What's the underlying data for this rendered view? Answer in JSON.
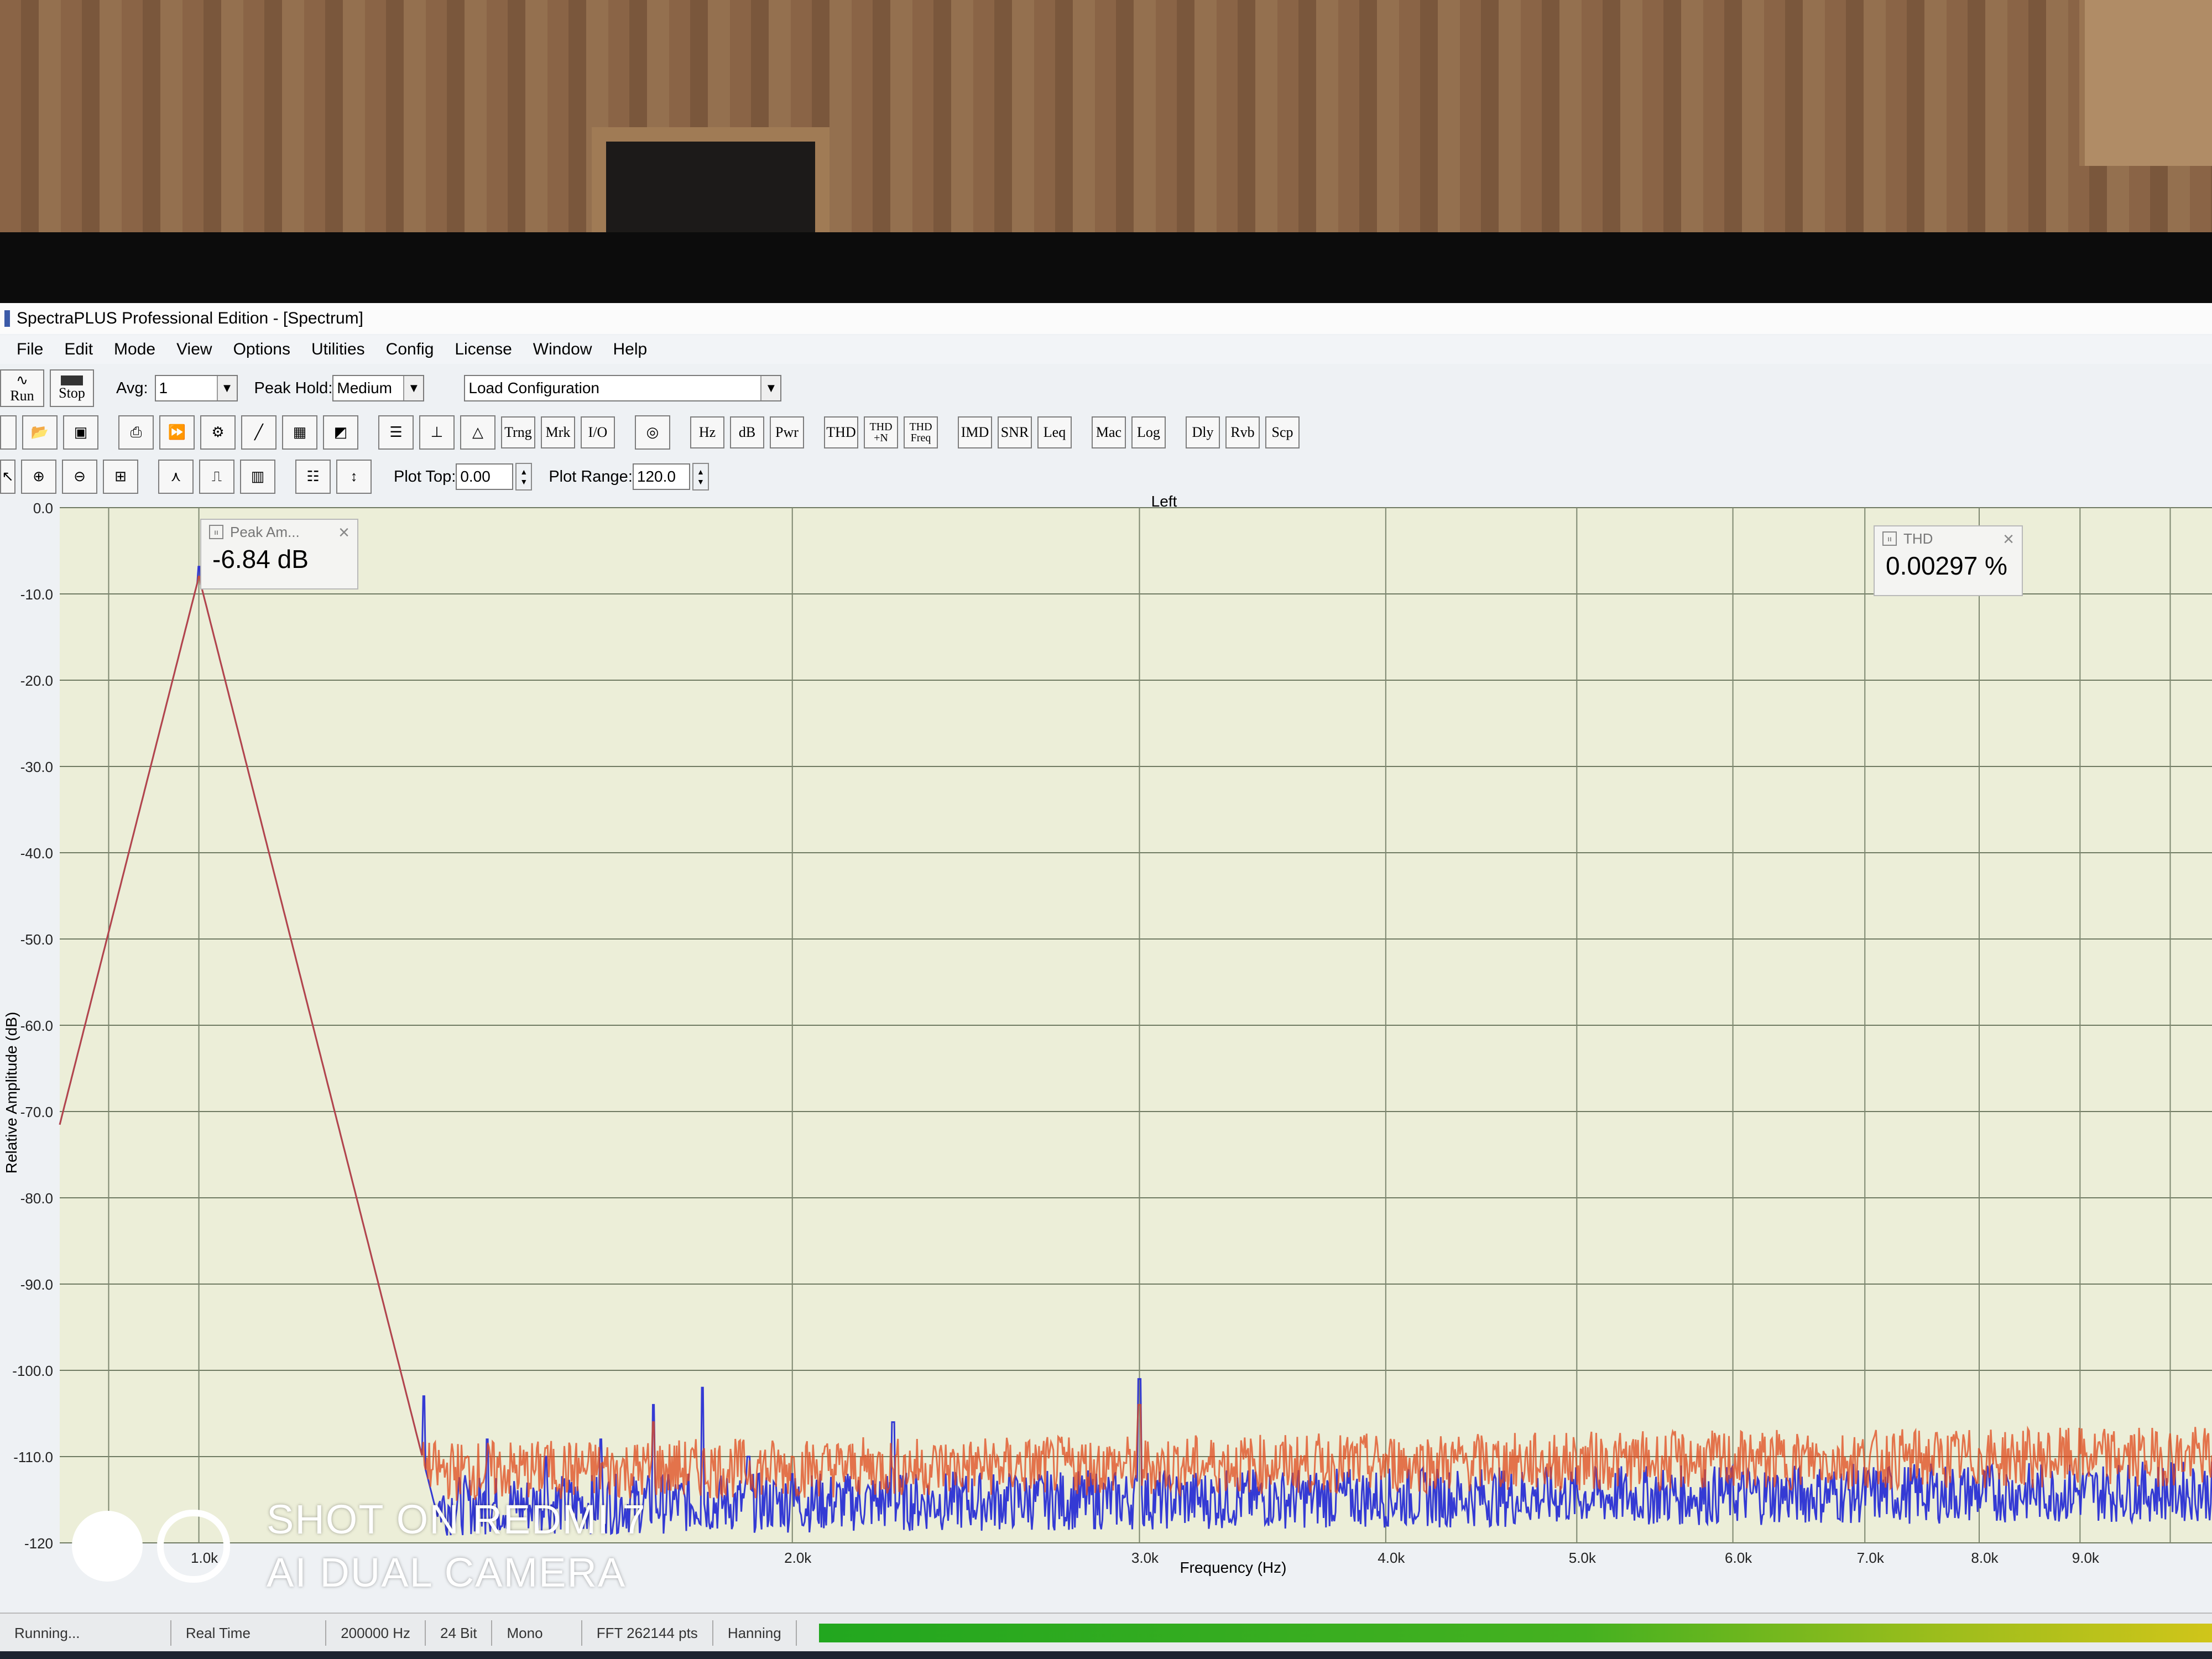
{
  "window": {
    "title": "SpectraPLUS Professional Edition - [Spectrum]"
  },
  "menu": [
    "File",
    "Edit",
    "Mode",
    "View",
    "Options",
    "Utilities",
    "Config",
    "License",
    "Window",
    "Help"
  ],
  "toolbar1": {
    "run_label": "Run",
    "stop_label": "Stop",
    "avg_label": "Avg:",
    "avg_value": "1",
    "peak_hold_label": "Peak Hold:",
    "peak_hold_value": "Medium",
    "config_value": "Load Configuration"
  },
  "toolbar2": {
    "text_buttons": [
      "Hz",
      "dB",
      "Pwr",
      "THD",
      "THD +N",
      "THD Freq",
      "IMD",
      "SNR",
      "Leq",
      "Mac",
      "Log",
      "Dly",
      "Rvb",
      "Scp"
    ]
  },
  "toolbar3": {
    "plot_top_label": "Plot Top:",
    "plot_top_value": "0.00",
    "plot_range_label": "Plot Range:",
    "plot_range_value": "120.0"
  },
  "readouts": {
    "peak": {
      "title": "Peak Am...",
      "value": "-6.84 dB"
    },
    "thd": {
      "title": "THD",
      "value": "0.00297 %"
    }
  },
  "chart_data": {
    "type": "line",
    "title": "Left",
    "xlabel": "Frequency (Hz)",
    "ylabel": "Relative Amplitude (dB)",
    "xscale": "log",
    "xlim": [
      850,
      10500
    ],
    "ylim": [
      -120,
      0
    ],
    "y_ticks": [
      "0.0",
      "-10.0",
      "-20.0",
      "-30.0",
      "-40.0",
      "-50.0",
      "-60.0",
      "-70.0",
      "-80.0",
      "-90.0",
      "-100.0",
      "-110.0",
      "-120"
    ],
    "x_ticks": [
      "1.0k",
      "2.0k",
      "3.0k",
      "4.0k",
      "5.0k",
      "6.0k",
      "7.0k",
      "8.0k",
      "9.0k"
    ],
    "grid": true,
    "series": [
      {
        "color": "#2a2fd4",
        "peaks": [
          [
            1000,
            -6.84
          ],
          [
            1100,
            -97
          ],
          [
            1200,
            -100
          ],
          [
            1300,
            -103
          ],
          [
            1400,
            -108
          ],
          [
            1500,
            -110
          ],
          [
            1600,
            -108
          ],
          [
            1700,
            -104
          ],
          [
            1800,
            -102
          ],
          [
            1900,
            -110
          ],
          [
            2000,
            -112
          ],
          [
            2250,
            -106
          ],
          [
            3000,
            -101
          ],
          [
            5000,
            -114
          ]
        ]
      },
      {
        "color": "#e04a1c",
        "peaks": [
          [
            1000,
            -8
          ],
          [
            1100,
            -95
          ],
          [
            1500,
            -109
          ],
          [
            1700,
            -106
          ],
          [
            2000,
            -110
          ],
          [
            3000,
            -104
          ]
        ]
      }
    ],
    "noise_floor": {
      "start_db": -114,
      "end_db": -112
    }
  },
  "status": {
    "state": "Running...",
    "mode": "Real Time",
    "sample_rate": "200000 Hz",
    "bits": "24 Bit",
    "channels": "Mono",
    "fft": "FFT 262144 pts",
    "window": "Hanning"
  },
  "watermark": {
    "line1": "SHOT ON REDMI 7",
    "line2": "AI DUAL CAMERA"
  }
}
